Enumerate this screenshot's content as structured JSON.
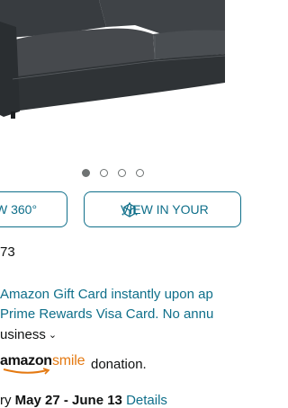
{
  "carousel": {
    "slide_count": 4,
    "active_index": 0
  },
  "buttons": {
    "view_360": "W 360°",
    "view_in_room": "VIEW IN YOUR"
  },
  "price_fragment": "73",
  "offer": {
    "line1": "Amazon Gift Card instantly upon ap",
    "line2": "Prime Rewards Visa Card. No annu",
    "line3": "usiness"
  },
  "smile": {
    "brand_amazon": "amazon",
    "brand_smile": "smile",
    "donation_text": "donation."
  },
  "delivery": {
    "prefix": "ry",
    "dates": "May 27 - June 13",
    "details_link": "Details"
  },
  "colors": {
    "link": "#0f6f8a",
    "smile_orange": "#e47911",
    "sofa": "#3b3f43"
  },
  "icons": {
    "room_icon": "ar-cube-icon",
    "chevron": "chevron-down-icon"
  }
}
